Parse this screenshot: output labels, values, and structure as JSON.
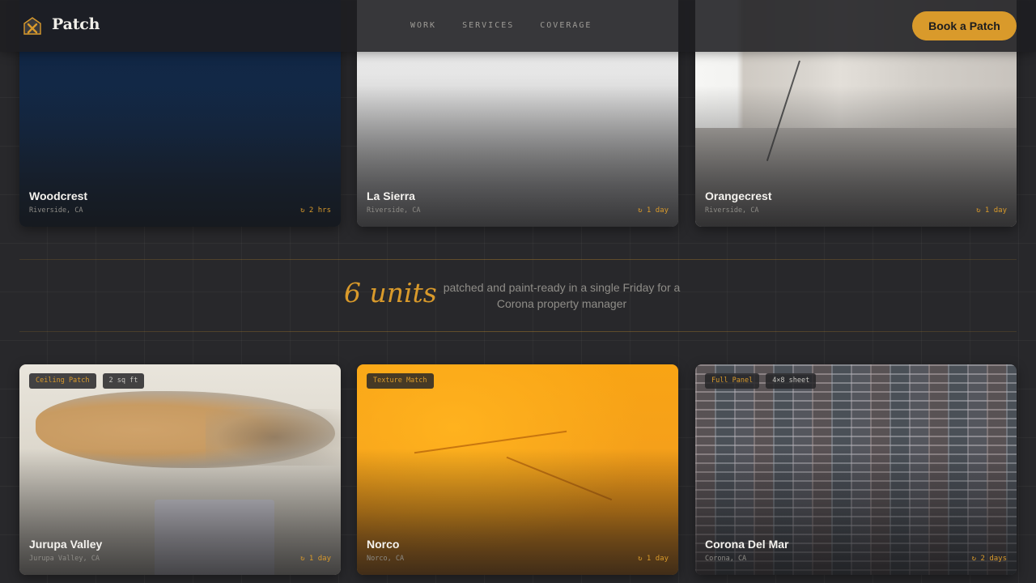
{
  "header": {
    "brand": "Patch",
    "logo_icon": "house-x-icon",
    "nav": [
      "WORK",
      "SERVICES",
      "COVERAGE"
    ],
    "cta_label": "Book a Patch"
  },
  "projects_top": [
    {
      "title": "Woodcrest",
      "location": "Riverside, CA",
      "duration": "↻ 2 hrs"
    },
    {
      "title": "La Sierra",
      "location": "Riverside, CA",
      "duration": "↻ 1 day"
    },
    {
      "title": "Orangecrest",
      "location": "Riverside, CA",
      "duration": "↻ 1 day"
    }
  ],
  "stat": {
    "number": "6 units",
    "description": "patched and paint-ready in a single Friday for a Corona property manager"
  },
  "projects_bottom": [
    {
      "title": "Jurupa Valley",
      "location": "Jurupa Valley, CA",
      "duration": "↻ 1 day",
      "tags": [
        "Ceiling Patch",
        "2 sq ft"
      ]
    },
    {
      "title": "Norco",
      "location": "Norco, CA",
      "duration": "↻ 1 day",
      "tags": [
        "Texture Match"
      ]
    },
    {
      "title": "Corona Del Mar",
      "location": "Corona, CA",
      "duration": "↻ 2 days",
      "tags": [
        "Full Panel",
        "4×8 sheet"
      ]
    }
  ],
  "colors": {
    "accent": "#d99a2b",
    "background": "#28282b",
    "header": "#1e1e21"
  }
}
